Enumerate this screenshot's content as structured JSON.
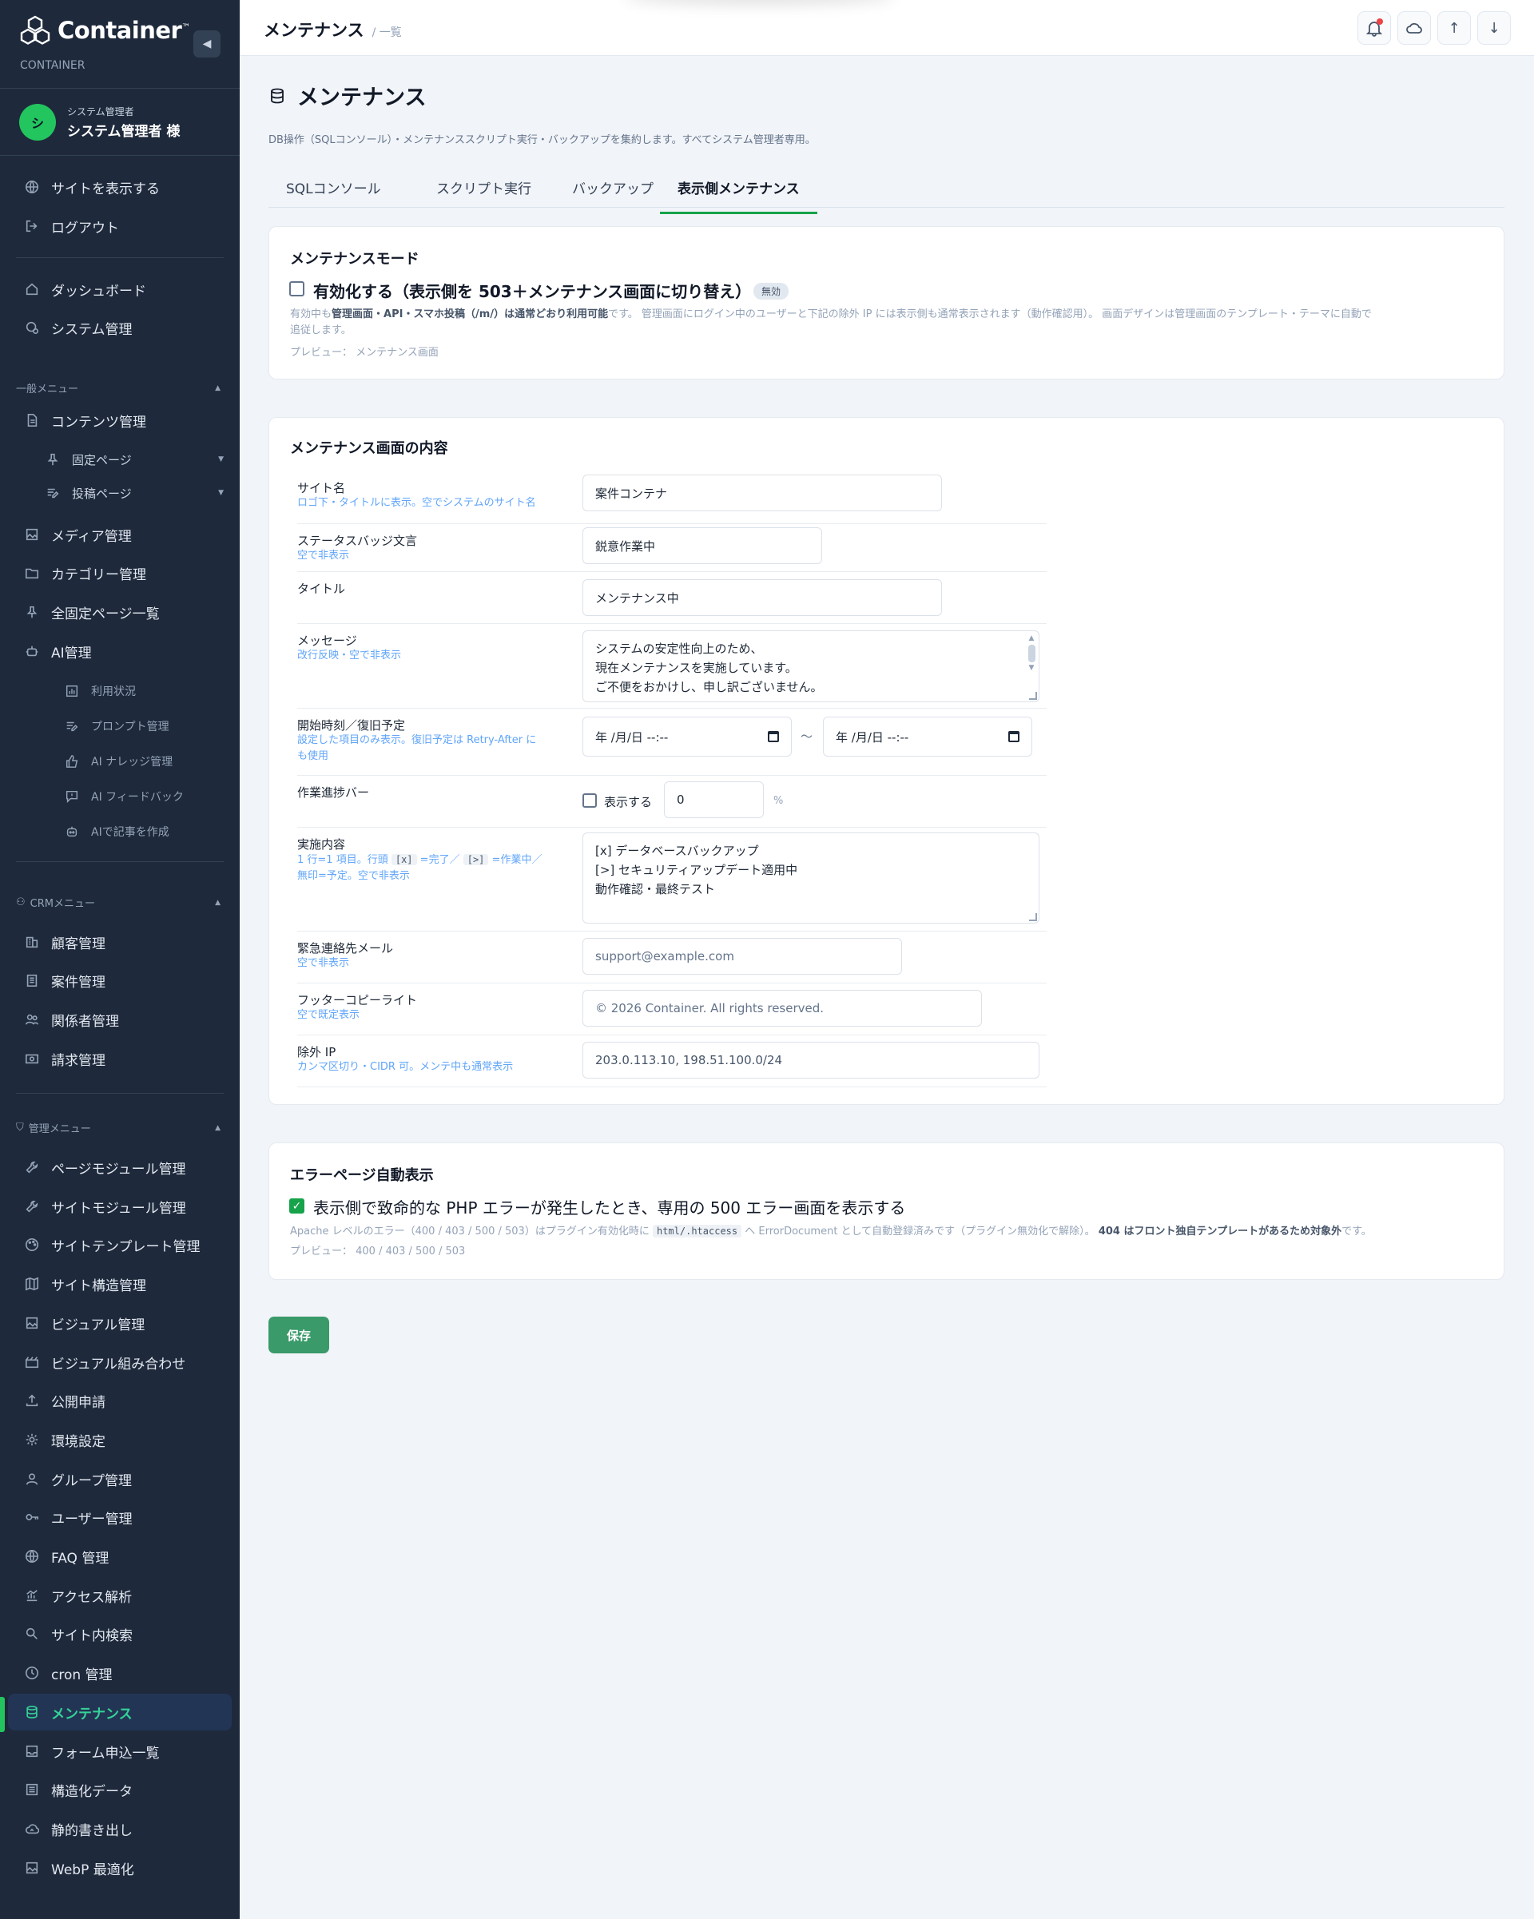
{
  "brand": {
    "name": "Container",
    "tm": "™",
    "sub": "CONTAINER"
  },
  "user": {
    "initial": "シ",
    "role": "システム管理者",
    "name": "システム管理者 様"
  },
  "sidebar": {
    "top_links": [
      {
        "label": "サイトを表示する",
        "icon": "globe-icon"
      },
      {
        "label": "ログアウト",
        "icon": "logout-icon"
      }
    ],
    "main": [
      {
        "label": "ダッシュボード",
        "icon": "home-icon"
      },
      {
        "label": "システム管理",
        "icon": "system-icon"
      }
    ],
    "general_section": "一般メニュー",
    "general": [
      {
        "label": "コンテンツ管理",
        "icon": "document-icon"
      },
      {
        "label": "固定ページ",
        "icon": "pin-icon"
      },
      {
        "label": "投稿ページ",
        "icon": "post-icon"
      },
      {
        "label": "メディア管理",
        "icon": "image-icon"
      },
      {
        "label": "カテゴリー管理",
        "icon": "folder-icon"
      },
      {
        "label": "全固定ページ一覧",
        "icon": "pin-icon"
      },
      {
        "label": "AI管理",
        "icon": "robot-icon"
      },
      {
        "label": "利用状況",
        "icon": "chart-icon"
      },
      {
        "label": "プロンプト管理",
        "icon": "edit-icon"
      },
      {
        "label": "AI ナレッジ管理",
        "icon": "thumbs-up-icon"
      },
      {
        "label": "AI フィードバック",
        "icon": "feedback-icon"
      },
      {
        "label": "AIで記事を作成",
        "icon": "robot-icon"
      }
    ],
    "crm_section": "CRMメニュー",
    "crm": [
      {
        "label": "顧客管理",
        "icon": "building-icon"
      },
      {
        "label": "案件管理",
        "icon": "clipboard-icon"
      },
      {
        "label": "関係者管理",
        "icon": "users-icon"
      },
      {
        "label": "請求管理",
        "icon": "invoice-icon"
      }
    ],
    "admin_section": "管理メニュー",
    "admin": [
      {
        "label": "ページモジュール管理",
        "icon": "wrench-icon"
      },
      {
        "label": "サイトモジュール管理",
        "icon": "wrench-icon"
      },
      {
        "label": "サイトテンプレート管理",
        "icon": "palette-icon"
      },
      {
        "label": "サイト構造管理",
        "icon": "map-icon"
      },
      {
        "label": "ビジュアル管理",
        "icon": "image-icon"
      },
      {
        "label": "ビジュアル組み合わせ",
        "icon": "clapper-icon"
      },
      {
        "label": "公開申請",
        "icon": "upload-icon"
      },
      {
        "label": "環境設定",
        "icon": "gear-icon"
      },
      {
        "label": "グループ管理",
        "icon": "user-icon"
      },
      {
        "label": "ユーザー管理",
        "icon": "key-icon"
      },
      {
        "label": "FAQ 管理",
        "icon": "globe-icon"
      },
      {
        "label": "アクセス解析",
        "icon": "analytics-icon"
      },
      {
        "label": "サイト内検索",
        "icon": "search-icon"
      },
      {
        "label": "cron 管理",
        "icon": "clock-icon"
      },
      {
        "label": "メンテナンス",
        "icon": "database-icon"
      },
      {
        "label": "フォーム申込一覧",
        "icon": "inbox-icon"
      },
      {
        "label": "構造化データ",
        "icon": "list-icon"
      },
      {
        "label": "静的書き出し",
        "icon": "cloud-icon"
      },
      {
        "label": "WebP 最適化",
        "icon": "image-icon"
      }
    ]
  },
  "topbar": {
    "title": "メンテナンス",
    "sub": "/ 一覧",
    "buttons": [
      {
        "icon": "bell-icon",
        "label": ""
      },
      {
        "icon": "cloud-icon",
        "label": ""
      },
      {
        "icon": "arrow-up-icon",
        "label": "↑"
      },
      {
        "icon": "arrow-down-icon",
        "label": "↓"
      }
    ]
  },
  "page": {
    "title": "メンテナンス",
    "description": "DB操作（SQLコンソール）・メンテナンススクリプト実行・バックアップを集約します。すべてシステム管理者専用。",
    "tabs": [
      "SQLコンソール",
      "スクリプト実行",
      "バックアップ",
      "表示側メンテナンス"
    ],
    "active_tab": 3
  },
  "mode_card": {
    "heading": "メンテナンスモード",
    "checkbox_label": "有効化する（表示側を 503＋メンテナンス画面に切り替え）",
    "checked": false,
    "badge": "無効",
    "note_pre": "有効中も",
    "note_bold": "管理画面・API・スマホ投稿（/m/）は通常どおり利用可能",
    "note_post": "です。 管理画面にログイン中のユーザーと下記の除外 IP には表示側も通常表示されます（動作確認用）。 画面デザインは管理画面のテンプレート・テーマに自動で",
    "note_line2": "追従します。",
    "preview": "プレビュー： メンテナンス画面"
  },
  "content_card": {
    "heading": "メンテナンス画面の内容",
    "site_name": {
      "label": "サイト名",
      "hint": "ロゴ下・タイトルに表示。空でシステムのサイト名",
      "value": "案件コンテナ"
    },
    "badge_text": {
      "label": "ステータスバッジ文言",
      "hint": "空で非表示",
      "value": "鋭意作業中"
    },
    "title": {
      "label": "タイトル",
      "value": "メンテナンス中"
    },
    "message": {
      "label": "メッセージ",
      "hint": "改行反映・空で非表示",
      "lines": [
        "システムの安定性向上のため、",
        "現在メンテナンスを実施しています。",
        "ご不便をおかけし、申し訳ございません。"
      ]
    },
    "schedule": {
      "label": "開始時刻／復旧予定",
      "hint1": "設定した項目のみ表示。復旧予定は Retry-After に",
      "hint2": "も使用",
      "start": "年 /月/日 --:--",
      "end": "年 /月/日 --:--",
      "sep": "〜"
    },
    "progress": {
      "label": "作業進捗バー",
      "check_label": "表示する",
      "checked": false,
      "value": "0",
      "unit": "%"
    },
    "tasks": {
      "label": "実施内容",
      "hint_a": "1 行=1 項目。行頭",
      "code_done": "[x]",
      "hint_b": "=完了／",
      "code_doing": "[>]",
      "hint_c": "=作業中／",
      "hint2": "無印=予定。空で非表示",
      "lines": [
        "[x] データベースバックアップ",
        "[>] セキュリティアップデート適用中",
        "動作確認・最終テスト"
      ]
    },
    "email": {
      "label": "緊急連絡先メール",
      "hint": "空で非表示",
      "placeholder": "support@example.com"
    },
    "copyright": {
      "label": "フッターコピーライト",
      "hint": "空で既定表示",
      "placeholder": "© 2026 Container. All rights reserved."
    },
    "exclude_ip": {
      "label": "除外 IP",
      "hint": "カンマ区切り・CIDR 可。メンテ中も通常表示",
      "value": "203.0.113.10, 198.51.100.0/24"
    }
  },
  "error_card": {
    "heading": "エラーページ自動表示",
    "checkbox_label": "表示側で致命的な PHP エラーが発生したとき、専用の 500 エラー画面を表示する",
    "checked": true,
    "note_a": "Apache レベルのエラー（400 / 403 / 500 / 503）はプラグイン有効化時に",
    "note_code": "html/.htaccess",
    "note_b": "へ ErrorDocument として自動登録済みです（プラグイン無効化で解除）。",
    "note_bold": "404 はフロント独自テンプレートがあるため対象外",
    "note_c": "です。",
    "preview": "プレビュー： 400 / 403 / 500 / 503"
  },
  "save_label": "保存",
  "colors": {
    "accent": "#16a34a",
    "sidebar_bg": "#1e293b",
    "save": "#3a9a6a"
  }
}
